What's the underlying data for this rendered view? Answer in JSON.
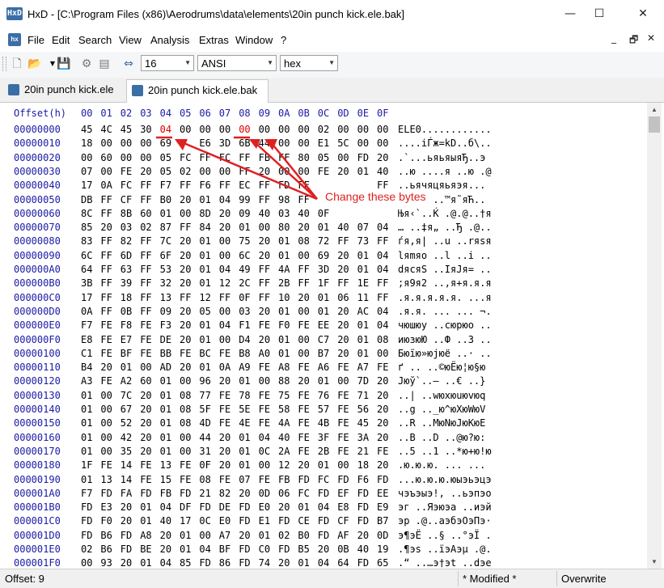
{
  "window": {
    "app_icon_text": "HxD",
    "title": "HxD - [C:\\Program Files (x86)\\Aerodrums\\data\\elements\\20in punch kick.ele.bak]",
    "minimize": "—",
    "maximize": "☐",
    "close": "✕"
  },
  "menu": {
    "items": [
      "File",
      "Edit",
      "Search",
      "View",
      "Analysis",
      "Extras",
      "Window",
      "?"
    ],
    "mdi_minimize": "_",
    "mdi_restore": "🗗",
    "mdi_close": "✕"
  },
  "toolbar": {
    "icons": [
      "new-file-icon",
      "open-folder-icon",
      "save-icon",
      "tools-icon",
      "database-icon",
      "bytes-per-row-icon"
    ],
    "bytes_per_row": "16",
    "charset": "ANSI",
    "offset_base": "hex"
  },
  "tabs": [
    {
      "label": "20in punch kick.ele",
      "active": false
    },
    {
      "label": "20in punch kick.ele.bak",
      "active": true
    }
  ],
  "editor": {
    "offset_header": "Offset(h)",
    "column_headers": [
      "00",
      "01",
      "02",
      "03",
      "04",
      "05",
      "06",
      "07",
      "08",
      "09",
      "0A",
      "0B",
      "0C",
      "0D",
      "0E",
      "0F"
    ],
    "rows": [
      {
        "offset": "00000000",
        "bytes": [
          "45",
          "4C",
          "45",
          "30",
          "04",
          "00",
          "00",
          "00",
          "00",
          "00",
          "00",
          "00",
          "02",
          "00",
          "00",
          "00"
        ],
        "text": "ELE0............"
      },
      {
        "offset": "00000010",
        "bytes": [
          "18",
          "00",
          "00",
          "00",
          "69",
          "",
          "E6",
          "3D",
          "6B",
          "44",
          "00",
          "00",
          "E1",
          "5C",
          "00",
          "00"
        ],
        "text": "....iЃж=kD..б\\.."
      },
      {
        "offset": "00000020",
        "bytes": [
          "00",
          "60",
          "00",
          "00",
          "05",
          "FC",
          "FF",
          "FC",
          "FF",
          "FB",
          "FF",
          "80",
          "05",
          "00",
          "FD",
          "20"
        ],
        "text": ".`...ьяьяыяЂ..э "
      },
      {
        "offset": "00000030",
        "bytes": [
          "07",
          "00",
          "FE",
          "20",
          "05",
          "02",
          "00",
          "00",
          "FF",
          "20",
          "00",
          "00",
          "FE",
          "20",
          "01",
          "40"
        ],
        "text": "..ю ....я ..ю .@"
      },
      {
        "offset": "00000040",
        "bytes": [
          "17",
          "0A",
          "FC",
          "FF",
          "F7",
          "FF",
          "F6",
          "FF",
          "EC",
          "FF",
          "FD",
          "FF",
          "",
          "",
          "",
          "FF"
        ],
        "text": "..ьячяцяьяэя..."
      },
      {
        "offset": "00000050",
        "bytes": [
          "DB",
          "FF",
          "CF",
          "FF",
          "B0",
          "20",
          "01",
          "04",
          "99",
          "FF",
          "98",
          "FF",
          "",
          "",
          "",
          "FF"
        ],
        "text": "ЫяПя° ..™я˜яЋ.."
      },
      {
        "offset": "00000060",
        "bytes": [
          "8C",
          "FF",
          "8B",
          "60",
          "01",
          "00",
          "8D",
          "20",
          "09",
          "40",
          "03",
          "40",
          "0F",
          "",
          "",
          "",
          "",
          ""
        ],
        "text": "Њя‹`..Ќ .@.@..†я"
      },
      {
        "offset": "00000070",
        "bytes": [
          "85",
          "20",
          "03",
          "02",
          "87",
          "FF",
          "84",
          "20",
          "01",
          "00",
          "80",
          "20",
          "01",
          "40",
          "07",
          "04"
        ],
        "text": "… ..‡я„ ..Ђ .@.."
      },
      {
        "offset": "00000080",
        "bytes": [
          "83",
          "FF",
          "82",
          "FF",
          "7C",
          "20",
          "01",
          "00",
          "75",
          "20",
          "01",
          "08",
          "72",
          "FF",
          "73",
          "FF"
        ],
        "text": "ѓя‚я| ..u ..rяsя"
      },
      {
        "offset": "00000090",
        "bytes": [
          "6C",
          "FF",
          "6D",
          "FF",
          "6F",
          "20",
          "01",
          "00",
          "6C",
          "20",
          "01",
          "00",
          "69",
          "20",
          "01",
          "04"
        ],
        "text": "lяmяo ..l ..i .."
      },
      {
        "offset": "000000A0",
        "bytes": [
          "64",
          "FF",
          "63",
          "FF",
          "53",
          "20",
          "01",
          "04",
          "49",
          "FF",
          "4A",
          "FF",
          "3D",
          "20",
          "01",
          "04"
        ],
        "text": "dяcяS ..IяJя= .."
      },
      {
        "offset": "000000B0",
        "bytes": [
          "3B",
          "FF",
          "39",
          "FF",
          "32",
          "20",
          "01",
          "12",
          "2C",
          "FF",
          "2B",
          "FF",
          "1F",
          "FF",
          "1E",
          "FF"
        ],
        "text": ";я9я2 ..,я+я.я.я"
      },
      {
        "offset": "000000C0",
        "bytes": [
          "17",
          "FF",
          "18",
          "FF",
          "13",
          "FF",
          "12",
          "FF",
          "0F",
          "FF",
          "10",
          "20",
          "01",
          "06",
          "11",
          "FF"
        ],
        "text": ".я.я.я.я.я. ...я"
      },
      {
        "offset": "000000D0",
        "bytes": [
          "0A",
          "FF",
          "0B",
          "FF",
          "09",
          "20",
          "05",
          "00",
          "03",
          "20",
          "01",
          "00",
          "01",
          "20",
          "AC",
          "04"
        ],
        "text": ".я.я. ... ... ¬."
      },
      {
        "offset": "000000E0",
        "bytes": [
          "F7",
          "FE",
          "F8",
          "FE",
          "F3",
          "20",
          "01",
          "04",
          "F1",
          "FE",
          "F0",
          "FE",
          "EE",
          "20",
          "01",
          "04"
        ],
        "text": "чюшюу ..сюрюо .."
      },
      {
        "offset": "000000F0",
        "bytes": [
          "E8",
          "FE",
          "E7",
          "FE",
          "DE",
          "20",
          "01",
          "00",
          "D4",
          "20",
          "01",
          "00",
          "C7",
          "20",
          "01",
          "08"
        ],
        "text": "июзюЮ ..Ф ..З .."
      },
      {
        "offset": "00000100",
        "bytes": [
          "C1",
          "FE",
          "BF",
          "FE",
          "BB",
          "FE",
          "BC",
          "FE",
          "B8",
          "A0",
          "01",
          "00",
          "B7",
          "20",
          "01",
          "00"
        ],
        "text": "Бюїю»юјюё ..· .."
      },
      {
        "offset": "00000110",
        "bytes": [
          "B4",
          "20",
          "01",
          "00",
          "AD",
          "20",
          "01",
          "0A",
          "A9",
          "FE",
          "A8",
          "FE",
          "A6",
          "FE",
          "A7",
          "FE"
        ],
        "text": "ґ ..­ ..©юЁю¦ю§ю"
      },
      {
        "offset": "00000120",
        "bytes": [
          "A3",
          "FE",
          "A2",
          "60",
          "01",
          "00",
          "96",
          "20",
          "01",
          "00",
          "88",
          "20",
          "01",
          "00",
          "7D",
          "20"
        ],
        "text": "Јюў`..– ..€ ..} "
      },
      {
        "offset": "00000130",
        "bytes": [
          "01",
          "00",
          "7C",
          "20",
          "01",
          "08",
          "77",
          "FE",
          "78",
          "FE",
          "75",
          "FE",
          "76",
          "FE",
          "71",
          "20"
        ],
        "text": "..| ..wюxюuюvюq "
      },
      {
        "offset": "00000140",
        "bytes": [
          "01",
          "00",
          "67",
          "20",
          "01",
          "08",
          "5F",
          "FE",
          "5E",
          "FE",
          "58",
          "FE",
          "57",
          "FE",
          "56",
          "20"
        ],
        "text": "..g .._ю^юXюWюV "
      },
      {
        "offset": "00000150",
        "bytes": [
          "01",
          "00",
          "52",
          "20",
          "01",
          "08",
          "4D",
          "FE",
          "4E",
          "FE",
          "4A",
          "FE",
          "4B",
          "FE",
          "45",
          "20"
        ],
        "text": "..R ..MюNюJюKюE "
      },
      {
        "offset": "00000160",
        "bytes": [
          "01",
          "00",
          "42",
          "20",
          "01",
          "00",
          "44",
          "20",
          "01",
          "04",
          "40",
          "FE",
          "3F",
          "FE",
          "3A",
          "20"
        ],
        "text": "..B ..D ..@ю?ю: "
      },
      {
        "offset": "00000170",
        "bytes": [
          "01",
          "00",
          "35",
          "20",
          "01",
          "00",
          "31",
          "20",
          "01",
          "0C",
          "2A",
          "FE",
          "2B",
          "FE",
          "21",
          "FE"
        ],
        "text": "..5 ..1 ..*ю+ю!ю"
      },
      {
        "offset": "00000180",
        "bytes": [
          "1F",
          "FE",
          "14",
          "FE",
          "13",
          "FE",
          "0F",
          "20",
          "01",
          "00",
          "12",
          "20",
          "01",
          "00",
          "18",
          "20"
        ],
        "text": ".ю.ю.ю. ... ... "
      },
      {
        "offset": "00000190",
        "bytes": [
          "01",
          "13",
          "14",
          "FE",
          "15",
          "FE",
          "08",
          "FE",
          "07",
          "FE",
          "FB",
          "FD",
          "FC",
          "FD",
          "F6",
          "FD"
        ],
        "text": "...ю.ю.ю.юыэьэцэ"
      },
      {
        "offset": "000001A0",
        "bytes": [
          "F7",
          "FD",
          "FA",
          "FD",
          "FB",
          "FD",
          "21",
          "82",
          "20",
          "0D",
          "06",
          "FC",
          "FD",
          "EF",
          "FD",
          "EE"
        ],
        "text": "чэъэыэ!‚ ..ьэпэо"
      },
      {
        "offset": "000001B0",
        "bytes": [
          "FD",
          "E3",
          "20",
          "01",
          "04",
          "DF",
          "FD",
          "DE",
          "FD",
          "E0",
          "20",
          "01",
          "04",
          "E8",
          "FD",
          "E9"
        ],
        "text": "эг ..Яэюэа ..иэй"
      },
      {
        "offset": "000001C0",
        "bytes": [
          "FD",
          "F0",
          "20",
          "01",
          "40",
          "17",
          "0C",
          "E0",
          "FD",
          "E1",
          "FD",
          "CE",
          "FD",
          "CF",
          "FD",
          "B7"
        ],
        "text": "эр .@..аэбэОэПэ·"
      },
      {
        "offset": "000001D0",
        "bytes": [
          "FD",
          "B6",
          "FD",
          "A8",
          "20",
          "01",
          "00",
          "A7",
          "20",
          "01",
          "02",
          "B0",
          "FD",
          "AF",
          "20",
          "0D"
        ],
        "text": "э¶эЁ ..§ ..°эЇ ."
      },
      {
        "offset": "000001E0",
        "bytes": [
          "02",
          "B6",
          "FD",
          "BE",
          "20",
          "01",
          "04",
          "BF",
          "FD",
          "C0",
          "FD",
          "B5",
          "20",
          "0B",
          "40",
          "19"
        ],
        "text": ".¶эѕ ..їэАэµ .@."
      },
      {
        "offset": "000001F0",
        "bytes": [
          "00",
          "93",
          "20",
          "01",
          "04",
          "85",
          "FD",
          "86",
          "FD",
          "74",
          "20",
          "01",
          "04",
          "64",
          "FD",
          "65"
        ],
        "text": ".“ ..…э†эt ..dэe"
      }
    ]
  },
  "annotation": {
    "label": "Change these bytes",
    "color": "#e02020"
  },
  "status": {
    "offset": "Offset: 9",
    "modified": "* Modified *",
    "mode": "Overwrite"
  },
  "colors": {
    "offset_blue": "#1a1aa6",
    "annotation_red": "#e02020",
    "highlight_red": "#e00000"
  }
}
